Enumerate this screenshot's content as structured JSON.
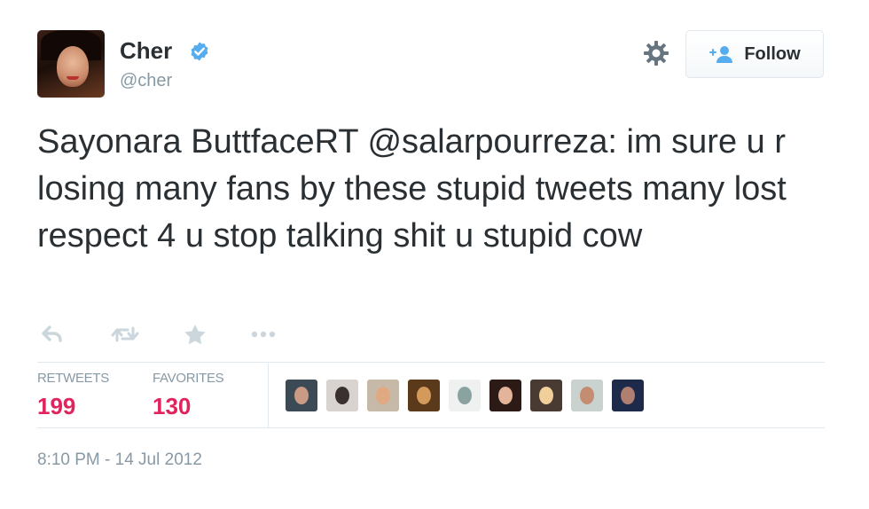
{
  "user": {
    "display_name": "Cher",
    "handle": "@cher",
    "verified": true
  },
  "header": {
    "follow_label": "Follow"
  },
  "tweet": {
    "text": "Sayonara ButtfaceRT @salarpourreza: im sure u r losing many fans by these stupid tweets many lost respect 4 u stop talking shit u stupid cow",
    "timestamp": "8:10 PM - 14 Jul 2012"
  },
  "actions": [
    {
      "name": "reply-icon"
    },
    {
      "name": "retweet-icon"
    },
    {
      "name": "favorite-star-icon"
    },
    {
      "name": "more-dots-icon"
    }
  ],
  "stats": {
    "retweets_label": "RETWEETS",
    "retweets_count": "199",
    "favorites_label": "FAVORITES",
    "favorites_count": "130"
  },
  "favoriters": [
    {
      "bg": "#3b4a55",
      "face": "#c99a84"
    },
    {
      "bg": "#d8d3cf",
      "face": "#3a3030"
    },
    {
      "bg": "#c7b9a8",
      "face": "#e0a982"
    },
    {
      "bg": "#5a3a1a",
      "face": "#d39a5b"
    },
    {
      "bg": "#eef1f0",
      "face": "#8aa3a0"
    },
    {
      "bg": "#2b1a16",
      "face": "#e3b49a"
    },
    {
      "bg": "#4a3a34",
      "face": "#f0cf9a"
    },
    {
      "bg": "#c9d2cf",
      "face": "#c48c70"
    },
    {
      "bg": "#1d2a4a",
      "face": "#b07f72"
    }
  ],
  "colors": {
    "accent_blue": "#55acee",
    "stat_number": "#e0245e",
    "muted": "#8899a6",
    "text": "#292f33"
  }
}
